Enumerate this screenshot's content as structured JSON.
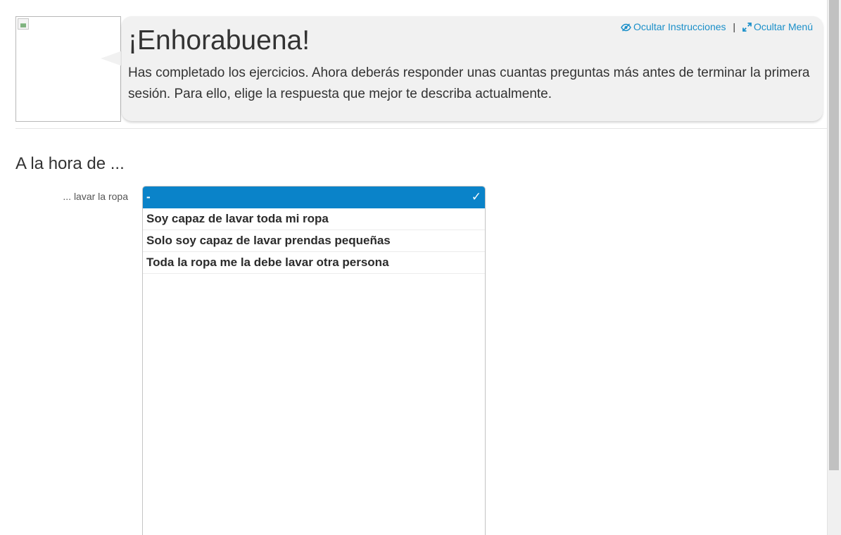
{
  "header": {
    "title": "¡Enhorabuena!",
    "message": "Has completado los ejercicios. Ahora deberás responder unas cuantas preguntas más antes de terminar la primera sesión. Para ello, elige la respuesta que mejor te describa actualmente.",
    "hide_instructions_label": "Ocultar Instrucciones",
    "separator": "|",
    "hide_menu_label": "Ocultar Menú",
    "link_color": "#1a8fc9"
  },
  "section": {
    "title": "A la hora de ..."
  },
  "question": {
    "label": "... lavar la ropa",
    "selected_color": "#0a83c9",
    "check_glyph": "✓",
    "options": [
      {
        "label": "-",
        "selected": true
      },
      {
        "label": "Soy capaz de lavar toda mi ropa",
        "selected": false
      },
      {
        "label": "Solo soy capaz de lavar prendas pequeñas",
        "selected": false
      },
      {
        "label": "Toda la ropa me la debe lavar otra persona",
        "selected": false
      }
    ]
  }
}
